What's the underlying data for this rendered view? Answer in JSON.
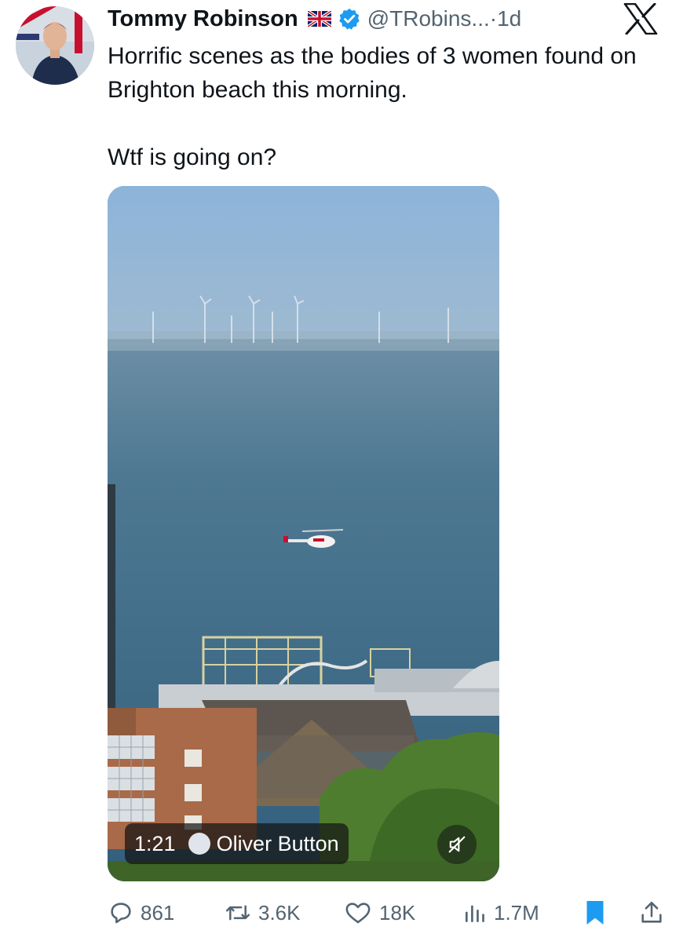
{
  "tweet": {
    "author_name": "Tommy Robinson",
    "handle": "@TRobins...",
    "separator": "·",
    "time": "1d",
    "text_lines": [
      "Horrific scenes as the bodies of 3 women found on Brighton beach this morning.",
      "Wtf is going on?"
    ]
  },
  "video": {
    "duration": "1:21",
    "creator": "Oliver Button"
  },
  "actions": {
    "replies": "861",
    "reposts": "3.6K",
    "likes": "18K",
    "views": "1.7M"
  },
  "icons": {
    "flag": "uk-flag-icon",
    "verified": "verified-badge-icon",
    "brand": "x-logo-icon",
    "reply": "reply-icon",
    "repost": "repost-icon",
    "like": "heart-icon",
    "views": "views-chart-icon",
    "bookmark": "bookmark-icon",
    "share": "share-icon",
    "mute": "muted-speaker-icon"
  },
  "colors": {
    "text": "#0f1419",
    "secondary": "#536471",
    "verified": "#1d9bf0",
    "bookmark": "#1d9bf0"
  }
}
